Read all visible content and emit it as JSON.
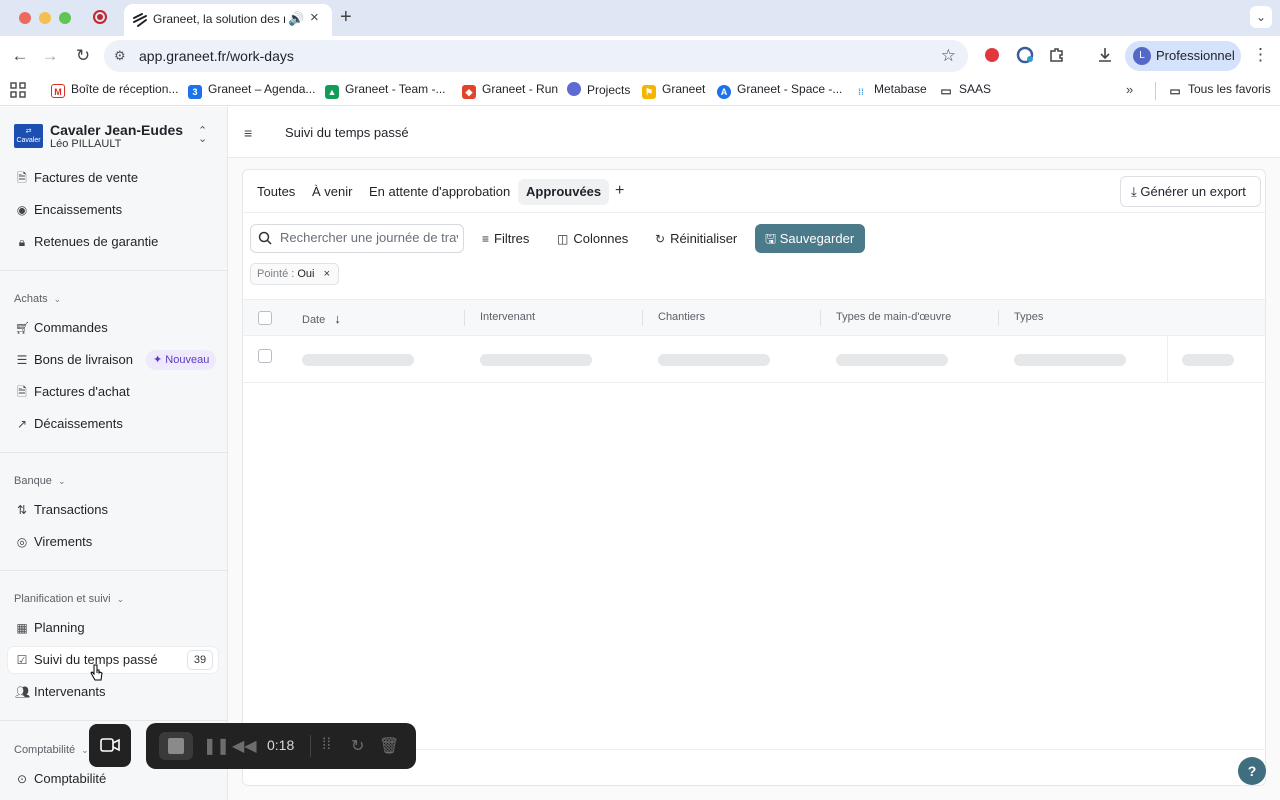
{
  "browser": {
    "tab_title": "Graneet, la solution des m",
    "url": "app.graneet.fr/work-days",
    "profile_initial": "L",
    "profile_name": "Professionnel",
    "bookmarks": [
      {
        "label": "Boîte de réception...",
        "icon": "gmail-icon",
        "color": "#d93025"
      },
      {
        "label": "Graneet – Agenda...",
        "icon": "calendar-icon",
        "color": "#1a73e8"
      },
      {
        "label": "Graneet - Team -...",
        "icon": "drive-icon",
        "color": "#0f9d58"
      },
      {
        "label": "Graneet - Run",
        "icon": "gitlab-icon",
        "color": "#e24329"
      },
      {
        "label": "Projects",
        "icon": "linear-icon",
        "color": "#5e6ad2"
      },
      {
        "label": "Graneet",
        "icon": "flag-icon",
        "color": "#f4b400"
      },
      {
        "label": "Graneet - Space -...",
        "icon": "space-icon",
        "color": "#1a73e8"
      },
      {
        "label": "Metabase",
        "icon": "metabase-icon",
        "color": "#509ee3"
      },
      {
        "label": "SAAS",
        "icon": "folder-icon",
        "color": "#444444"
      }
    ],
    "all_bookmarks_label": "Tous les favoris"
  },
  "sidebar": {
    "org_logo_text": "Cavaler",
    "org_name": "Cavaler Jean-Eudes",
    "user_name": "Léo PILLAULT",
    "items_top": [
      {
        "label": "Factures de vente",
        "icon": "invoice-icon"
      },
      {
        "label": "Encaissements",
        "icon": "cash-in-icon"
      },
      {
        "label": "Retenues de garantie",
        "icon": "lock-icon"
      }
    ],
    "achats": {
      "title": "Achats",
      "items": [
        {
          "label": "Commandes",
          "icon": "cart-icon"
        },
        {
          "label": "Bons de livraison",
          "icon": "delivery-list-icon",
          "badge": "Nouveau"
        },
        {
          "label": "Factures d'achat",
          "icon": "invoice-icon"
        },
        {
          "label": "Décaissements",
          "icon": "arrow-out-icon"
        }
      ]
    },
    "banque": {
      "title": "Banque",
      "items": [
        {
          "label": "Transactions",
          "icon": "transfer-arrows-icon"
        },
        {
          "label": "Virements",
          "icon": "transfer-icon"
        }
      ]
    },
    "planification": {
      "title": "Planification et suivi",
      "items": [
        {
          "label": "Planning",
          "icon": "calendar-icon"
        },
        {
          "label": "Suivi du temps passé",
          "icon": "checkbox-icon",
          "count": "39"
        },
        {
          "label": "Intervenants",
          "icon": "users-icon"
        }
      ]
    },
    "comptabilite": {
      "title": "Comptabilité",
      "items": [
        {
          "label": "Comptabilité",
          "icon": "accounting-icon"
        }
      ]
    }
  },
  "main": {
    "page_title": "Suivi du temps passé",
    "tabs": [
      "Toutes",
      "À venir",
      "En attente d'approbation",
      "Approuvées"
    ],
    "active_tab": "Approuvées",
    "export_label": "Générer un export",
    "search_placeholder": "Rechercher une journée de trav",
    "filters_label": "Filtres",
    "columns_label": "Colonnes",
    "reset_label": "Réinitialiser",
    "save_label": "Sauvegarder",
    "filter_chip": {
      "label": "Pointé :",
      "value": "Oui"
    },
    "table": {
      "headers": [
        "Date",
        "Intervenant",
        "Chantiers",
        "Types de main-d'œuvre",
        "Types"
      ],
      "sort": "descending",
      "rows_loading": true
    }
  },
  "recorder": {
    "time": "0:18"
  },
  "help_label": "?"
}
